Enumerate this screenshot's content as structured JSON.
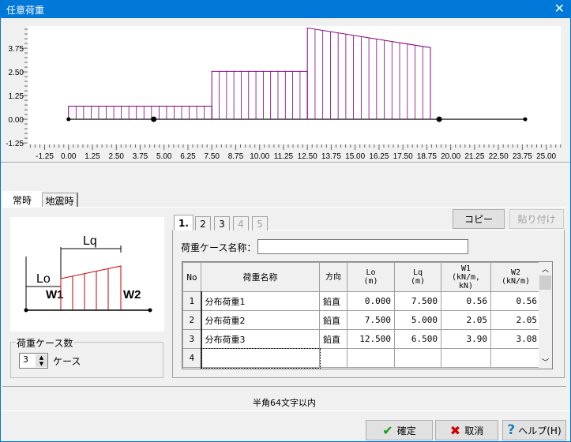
{
  "window": {
    "title": "任意荷重",
    "close_icon": "close-icon",
    "accent": "#0078d7"
  },
  "chart_data": {
    "type": "line",
    "xlim": [
      -2.14,
      25.76
    ],
    "ylim": [
      -1.33,
      4.92
    ],
    "xticks": [
      "-1.25",
      "0.00",
      "1.25",
      "2.50",
      "3.75",
      "5.00",
      "6.25",
      "7.50",
      "8.75",
      "10.00",
      "11.25",
      "12.50",
      "13.75",
      "15.00",
      "16.25",
      "17.50",
      "18.75",
      "20.00",
      "21.25",
      "22.50",
      "23.75",
      "25.00"
    ],
    "yticks": [
      "3.75",
      "2.50",
      "1.25",
      "0.00",
      "-1.25"
    ],
    "load_segments": [
      {
        "x1": 0,
        "x2": 7.5,
        "y1": 0.69,
        "y2": 0.69
      },
      {
        "x1": 7.5,
        "x2": 12.5,
        "y1": 2.53,
        "y2": 2.53
      },
      {
        "x1": 12.5,
        "x2": 18.94,
        "y1": 4.82,
        "y2": 3.78
      }
    ],
    "beam": {
      "x1": 0,
      "x2": 23.9
    },
    "nodes": [
      0,
      4.46,
      19.4,
      23.9
    ],
    "load_color": "#800080",
    "grid": false
  },
  "tabs": {
    "normal": "常時",
    "seismic": "地震時"
  },
  "diagram": {
    "lo": "Lo",
    "lq": "Lq",
    "w1": "W1",
    "w2": "W2"
  },
  "case_count": {
    "group_label": "荷重ケース数",
    "value": "3",
    "unit": "ケース"
  },
  "case_tabs": [
    "1.",
    "2",
    "3",
    "4",
    "5"
  ],
  "buttons": {
    "copy": "コピー",
    "paste": "貼り付け",
    "ok": "確定",
    "cancel": "取消",
    "help": "ヘルプ(H)"
  },
  "case_name": {
    "label": "荷重ケース名称：",
    "value": ""
  },
  "table": {
    "headers": [
      [
        "No",
        ""
      ],
      [
        "荷重名称",
        ""
      ],
      [
        "方向",
        ""
      ],
      [
        "Lo",
        "(m)"
      ],
      [
        "Lq",
        "(m)"
      ],
      [
        "W1",
        "(kN/m, kN)"
      ],
      [
        "W2",
        "(kN/m)"
      ]
    ],
    "rows": [
      {
        "no": "1",
        "name": "分布荷重1",
        "dir": "鉛直",
        "lo": "0.000",
        "lq": "7.500",
        "w1": "0.56",
        "w2": "0.56"
      },
      {
        "no": "2",
        "name": "分布荷重2",
        "dir": "鉛直",
        "lo": "7.500",
        "lq": "5.000",
        "w1": "2.05",
        "w2": "2.05"
      },
      {
        "no": "3",
        "name": "分布荷重3",
        "dir": "鉛直",
        "lo": "12.500",
        "lq": "6.500",
        "w1": "3.90",
        "w2": "3.08"
      },
      {
        "no": "4",
        "name": "",
        "dir": "",
        "lo": "",
        "lq": "",
        "w1": "",
        "w2": ""
      }
    ]
  },
  "status": "半角64文字以内"
}
